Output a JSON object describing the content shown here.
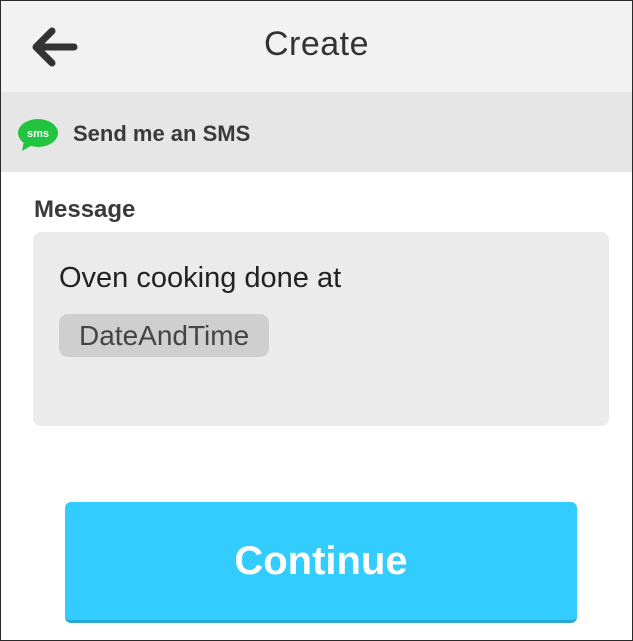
{
  "header": {
    "title": "Create",
    "back_icon": "arrow-left-icon"
  },
  "service": {
    "icon": "sms-icon",
    "icon_text": "sms",
    "icon_color": "#22c33f",
    "label": "Send me an SMS"
  },
  "message_field": {
    "label": "Message",
    "text": "Oven cooking done at",
    "ingredient": "DateAndTime"
  },
  "actions": {
    "continue_label": "Continue",
    "continue_color": "#33ccff"
  }
}
